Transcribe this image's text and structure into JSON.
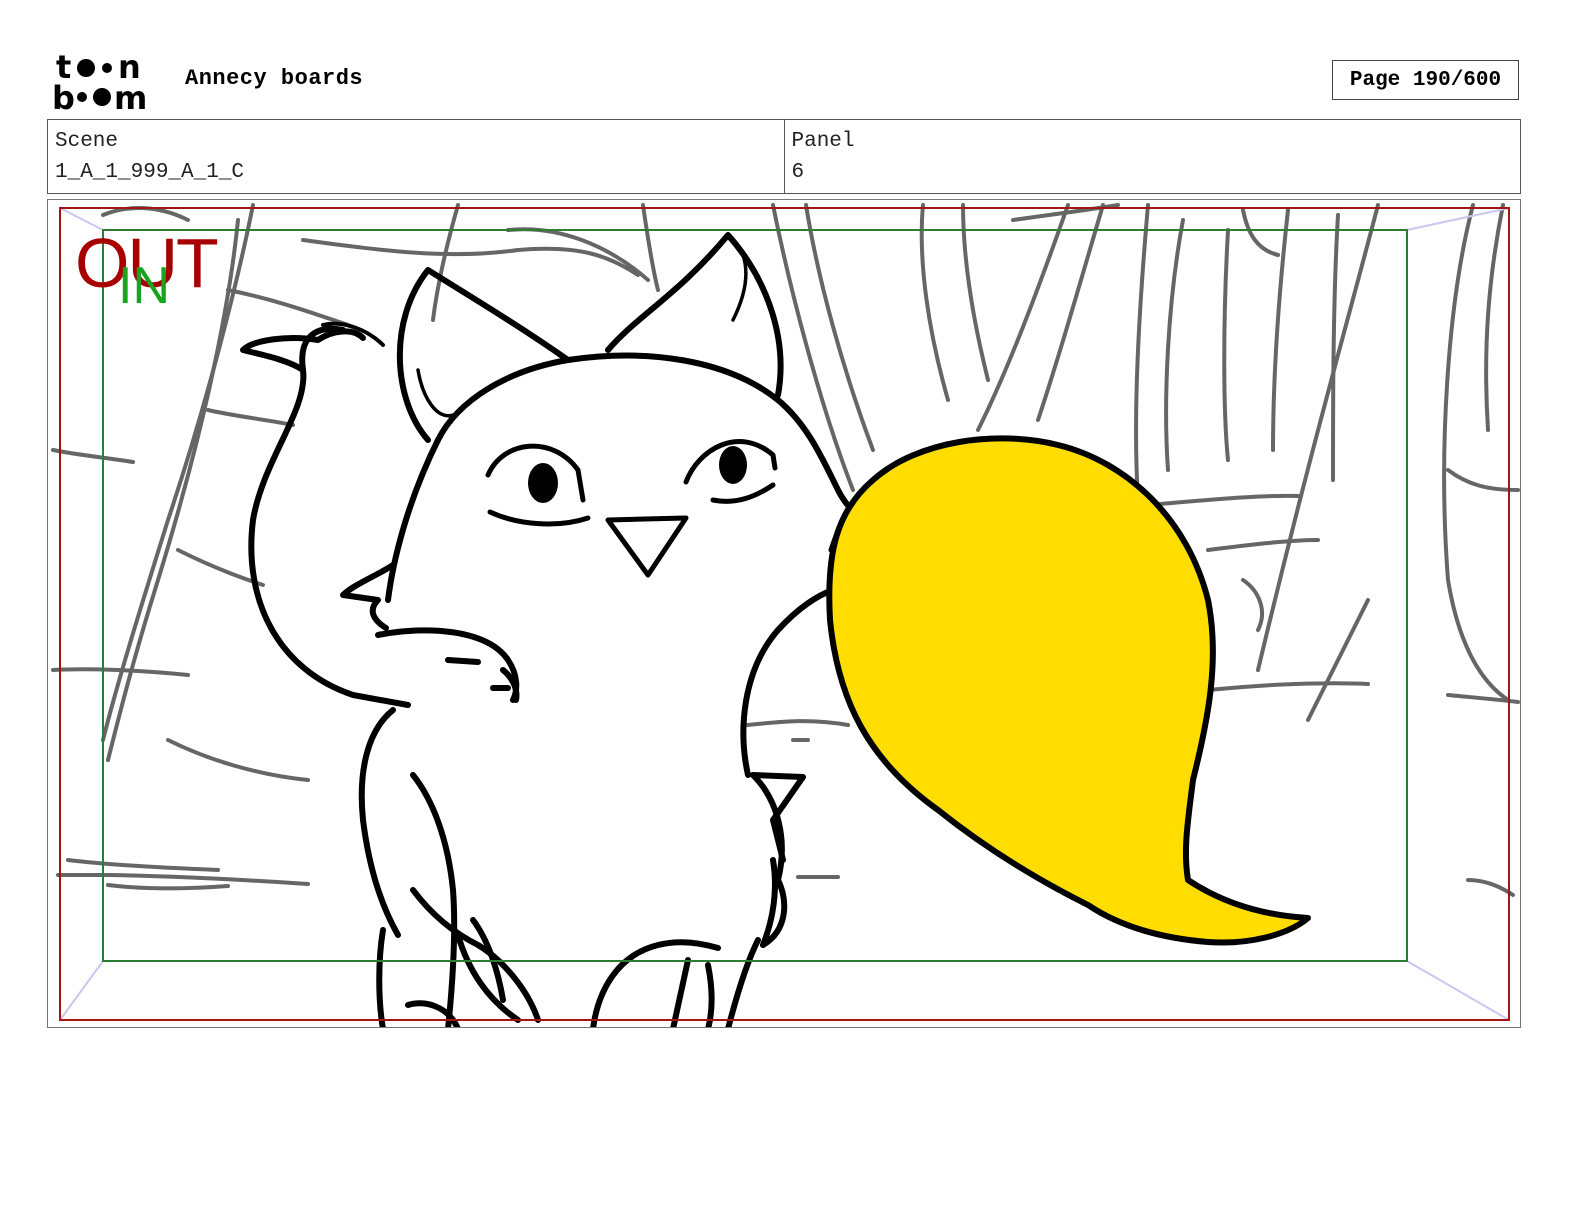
{
  "header": {
    "logo_top": "toon",
    "logo_bottom": "boom",
    "project_title": "Annecy boards",
    "page_label": "Page 190/600"
  },
  "info": {
    "scene_label": "Scene",
    "scene_value": "1_A_1_999_A_1_C",
    "panel_label": "Panel",
    "panel_value": "6"
  },
  "panel": {
    "out_label": "OUT",
    "in_label": "IN",
    "colors": {
      "out_frame": "#a31515",
      "in_frame": "#2e7d32",
      "out_text": "#a80000",
      "in_text": "#1aa321",
      "tail_fill": "#ffdd00",
      "background_lines": "#666666",
      "character_lines": "#000000",
      "camera_corners": "#c8c8f0"
    }
  }
}
